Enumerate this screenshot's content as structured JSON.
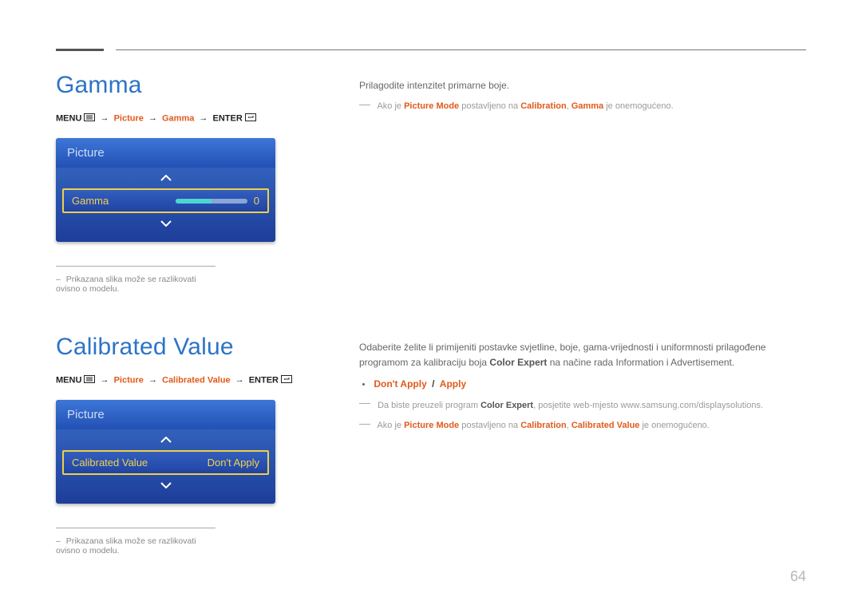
{
  "page_number": "64",
  "gamma": {
    "title": "Gamma",
    "breadcrumb": {
      "menu": "MENU",
      "path": [
        "Picture",
        "Gamma"
      ],
      "enter": "ENTER"
    },
    "osd": {
      "header": "Picture",
      "row_label": "Gamma",
      "row_value": "0"
    },
    "disclaimer": "Prikazana slika može se razlikovati ovisno o modelu.",
    "description": {
      "intro": "Prilagodite intenzitet primarne boje.",
      "note_prefix": "Ako je ",
      "note_pm": "Picture Mode",
      "note_mid": " postavljeno na ",
      "note_cal": "Calibration",
      "note_sep": ", ",
      "note_gam": "Gamma",
      "note_suffix": " je onemogućeno."
    }
  },
  "calibrated": {
    "title": "Calibrated Value",
    "breadcrumb": {
      "menu": "MENU",
      "path": [
        "Picture",
        "Calibrated Value"
      ],
      "enter": "ENTER"
    },
    "osd": {
      "header": "Picture",
      "row_label": "Calibrated Value",
      "row_value": "Don't Apply"
    },
    "disclaimer": "Prikazana slika može se razlikovati ovisno o modelu.",
    "description": {
      "intro_a": "Odaberite želite li primijeniti postavke svjetline, boje, gama-vrijednosti i uniformnosti prilagođene programom za kalibraciju boja ",
      "intro_bold": "Color Expert",
      "intro_b": " na načine rada Information i Advertisement.",
      "option_a": "Don't Apply",
      "option_b": "Apply",
      "note1_prefix": "Da biste preuzeli program ",
      "note1_bold": "Color Expert",
      "note1_suffix": ", posjetite web-mjesto www.samsung.com/displaysolutions.",
      "note2_prefix": "Ako je ",
      "note2_pm": "Picture Mode",
      "note2_mid": " postavljeno na ",
      "note2_cal": "Calibration",
      "note2_sep": ", ",
      "note2_cv": "Calibrated Value",
      "note2_suffix": " je onemogućeno."
    }
  }
}
